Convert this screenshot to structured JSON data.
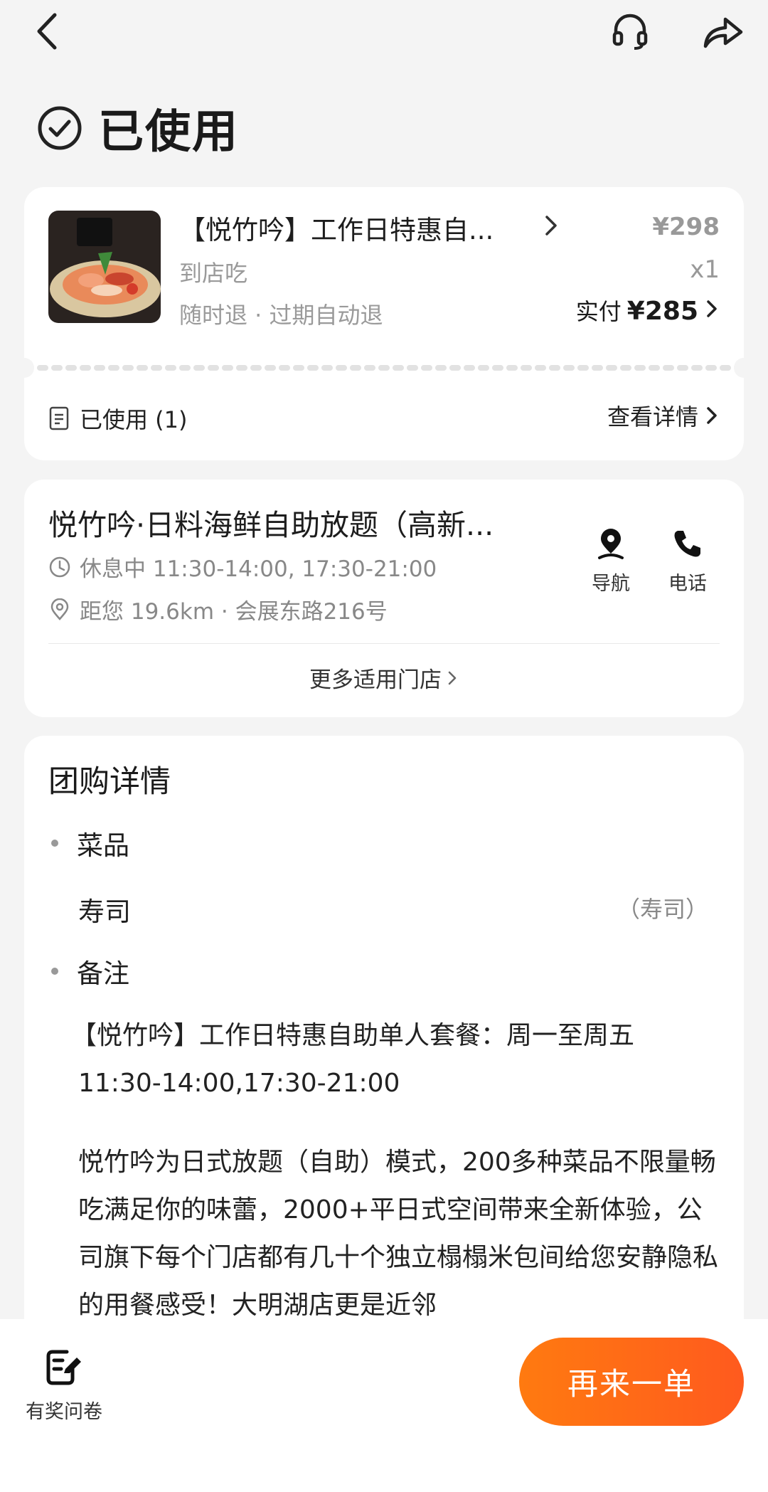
{
  "status": {
    "title": "已使用"
  },
  "order": {
    "product_name": "【悦竹吟】工作日特惠自...",
    "original_price": "¥298",
    "dine_type": "到店吃",
    "quantity": "x1",
    "refund_policy": "随时退 · 过期自动退",
    "paid_label": "实付",
    "paid_amount": "¥285",
    "used_count_label": "已使用 (1)",
    "view_detail_label": "查看详情"
  },
  "store": {
    "name": "悦竹吟·日料海鲜自助放题（高新...",
    "hours": "休息中 11:30-14:00, 17:30-21:00",
    "distance_address": "距您 19.6km  ·   会展东路216号",
    "navigate_label": "导航",
    "call_label": "电话",
    "more_stores_label": "更多适用门店"
  },
  "group_detail": {
    "title": "团购详情",
    "dishes_heading": "菜品",
    "dish_name": "寿司",
    "dish_category": "（寿司）",
    "notes_heading": "备注",
    "note_line1": "【悦竹吟】工作日特惠自助单人套餐：周一至周五 11:30-14:00,17:30-21:00",
    "note_line2": "悦竹吟为日式放题（自助）模式，200多种菜品不限量畅吃满足你的味蕾，2000+平日式空间带来全新体验，公司旗下每个门店都有几十个独立榻榻米包间给您安静隐私的用餐感受！大明湖店更是近邻"
  },
  "bottom_bar": {
    "survey_label": "有奖问卷",
    "reorder_label": "再来一单"
  },
  "colors": {
    "accent": "#ff6a14",
    "background": "#f4f4f4"
  }
}
